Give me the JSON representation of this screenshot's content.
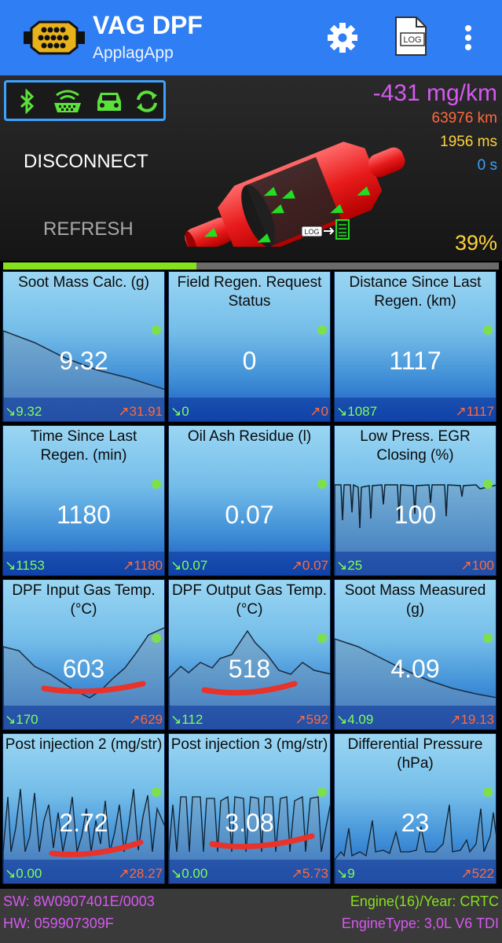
{
  "app": {
    "title": "VAG DPF",
    "subtitle": "ApplagApp"
  },
  "toolbar": {
    "settings_icon": "gear-icon",
    "log_label": "LOG",
    "more_icon": "more-vert-icon"
  },
  "status": {
    "icons": [
      "bluetooth-icon",
      "obd-adapter-icon",
      "car-icon",
      "sync-icon"
    ],
    "disconnect_label": "DISCONNECT",
    "refresh_label": "REFRESH",
    "readouts": {
      "rate": "-431 mg/km",
      "distance": "63976 km",
      "response": "1956 ms",
      "time": "0 s",
      "percent": "39%"
    },
    "log_badge": "LOG",
    "progress_fraction": 0.39
  },
  "tiles": [
    {
      "label": "Soot Mass Calc. (g)",
      "value": "9.32",
      "min": "↘9.32",
      "max": "↗31.91"
    },
    {
      "label": "Field Regen. Request Status",
      "value": "0",
      "min": "↘0",
      "max": "↗0"
    },
    {
      "label": "Distance Since Last Regen. (km)",
      "value": "1117",
      "min": "↘1087",
      "max": "↗1117"
    },
    {
      "label": "Time Since Last Regen. (min)",
      "value": "1180",
      "min": "↘1153",
      "max": "↗1180"
    },
    {
      "label": "Oil Ash Residue (l)",
      "value": "0.07",
      "min": "↘0.07",
      "max": "↗0.07"
    },
    {
      "label": "Low Press. EGR Closing (%)",
      "value": "100",
      "min": "↘25",
      "max": "↗100"
    },
    {
      "label": "DPF Input Gas Temp. (°C)",
      "value": "603",
      "min": "↘170",
      "max": "↗629"
    },
    {
      "label": "DPF Output Gas Temp. (°C)",
      "value": "518",
      "min": "↘112",
      "max": "↗592"
    },
    {
      "label": "Soot Mass Measured (g)",
      "value": "4.09",
      "min": "↘4.09",
      "max": "↗19.13"
    },
    {
      "label": "Post injection 2 (mg/str)",
      "value": "2.72",
      "min": "↘0.00",
      "max": "↗28.27"
    },
    {
      "label": "Post injection 3 (mg/str)",
      "value": "3.08",
      "min": "↘0.00",
      "max": "↗5.73"
    },
    {
      "label": "Differential Pressure (hPa)",
      "value": "23",
      "min": "↘9",
      "max": "↗522"
    }
  ],
  "footer": {
    "sw": "SW: 8W0907401E/0003",
    "hw": "HW: 059907309F",
    "engine": "Engine(16)/Year: CRTC",
    "engine_type": "EngineType: 3,0L V6 TDI"
  }
}
